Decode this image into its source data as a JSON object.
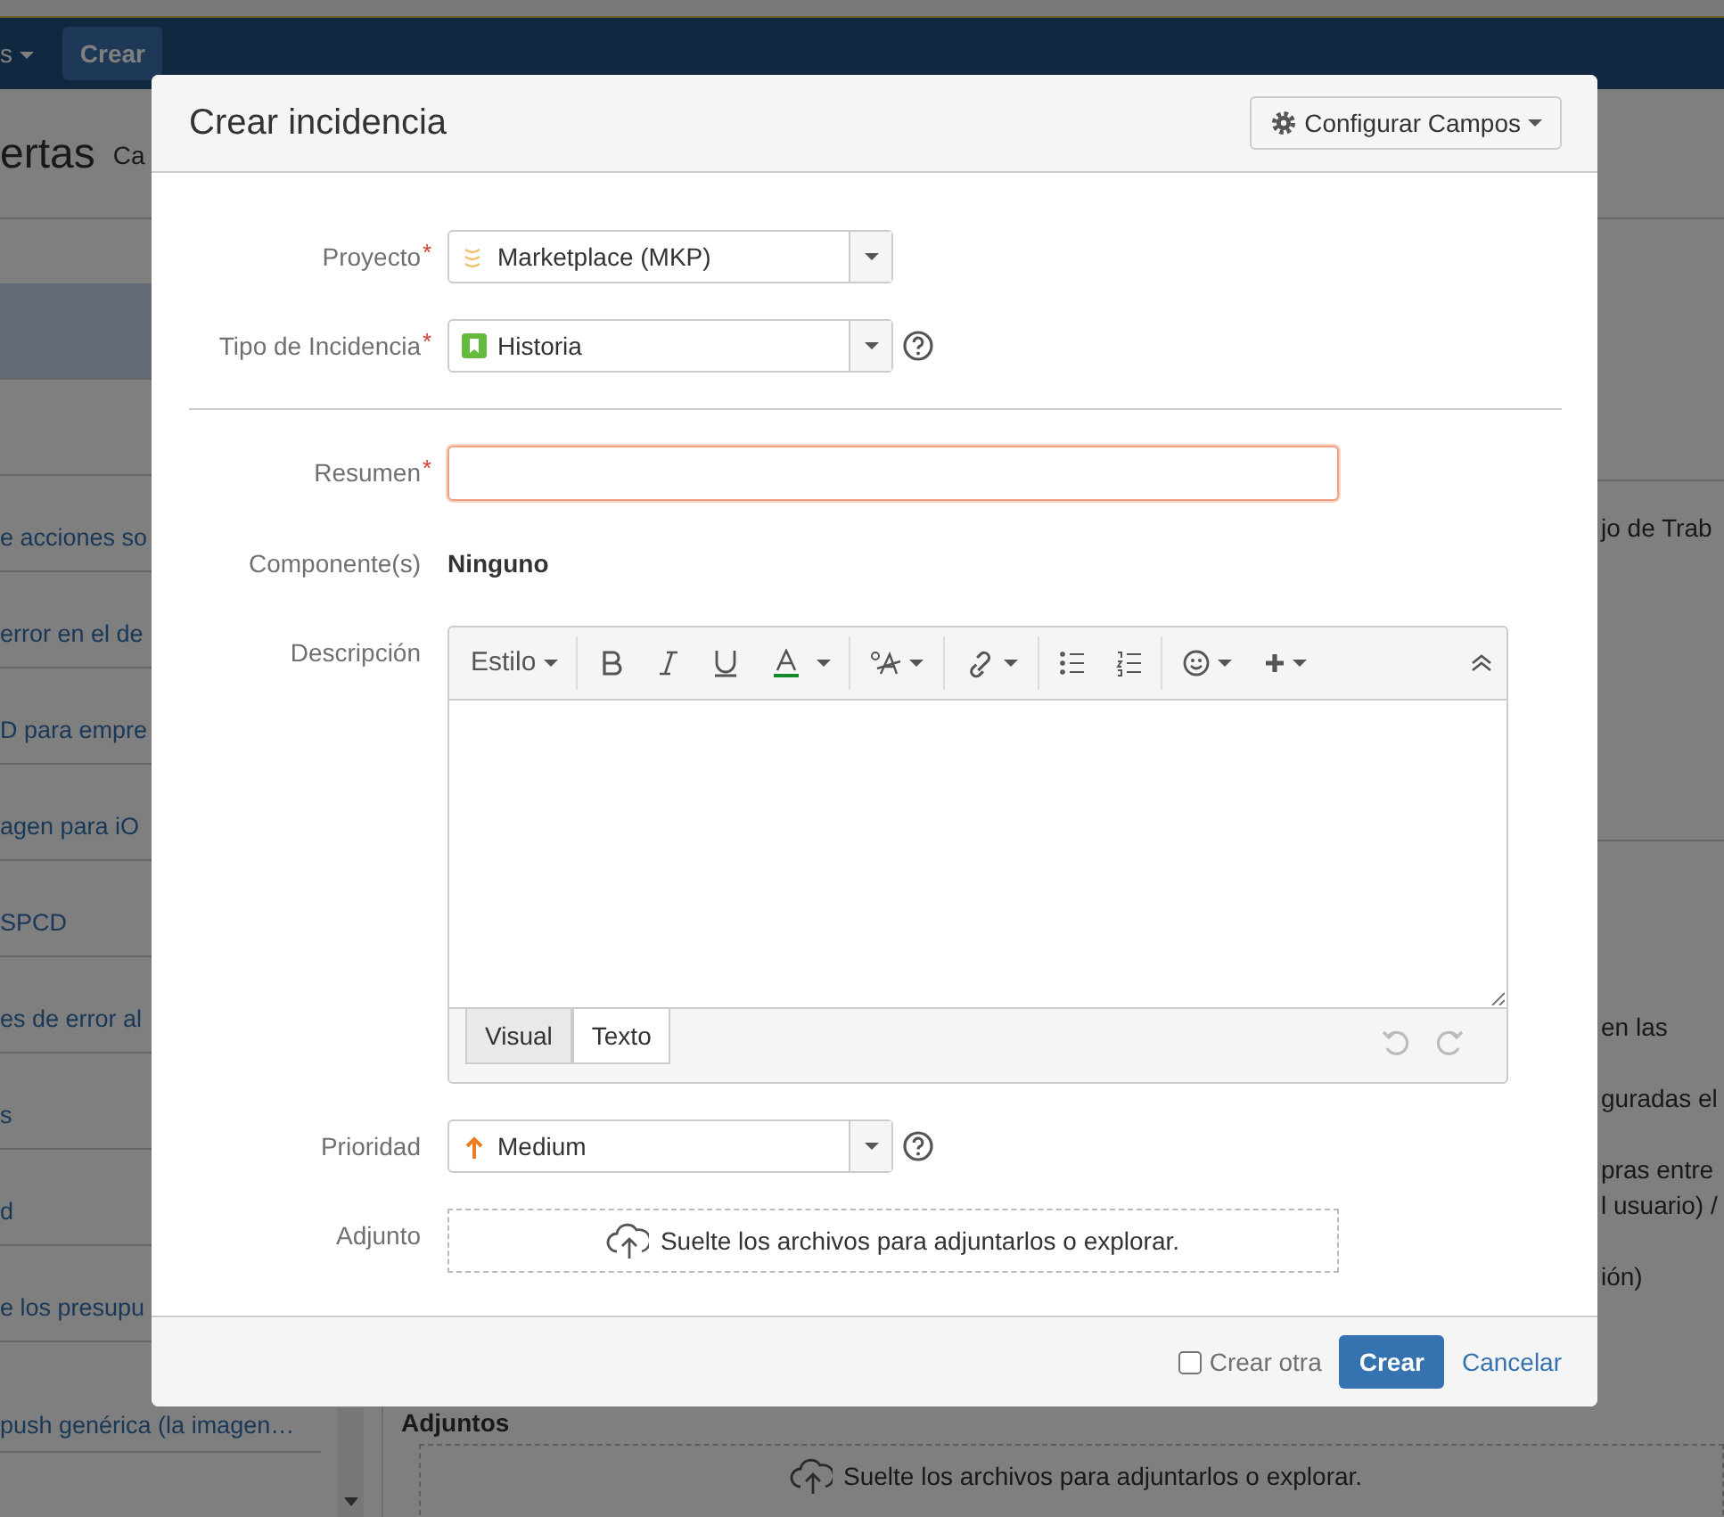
{
  "navbar": {
    "items": [
      {
        "kind": "menu",
        "label": "s"
      },
      {
        "kind": "button",
        "label": "Crear"
      }
    ]
  },
  "page_header": {
    "title": "ertas",
    "link": "Ca"
  },
  "issue_list": {
    "items": [
      {
        "selected": true
      },
      {
        "selected": false
      },
      {
        "text": "e acciones so",
        "selected": false
      },
      {
        "text": "error en el de",
        "selected": false
      },
      {
        "text": "D para empre",
        "selected": false
      },
      {
        "text": "agen para iO",
        "selected": false
      },
      {
        "text": "SPCD",
        "selected": false
      },
      {
        "text": "es de error al",
        "selected": false
      },
      {
        "text": "s",
        "selected": false
      },
      {
        "text": "d",
        "selected": false
      },
      {
        "text": "e los presupu",
        "selected": false
      },
      {
        "text": "push genérica (la imagen…",
        "selected": false
      }
    ]
  },
  "detail_panel": {
    "link": "jo de Trab",
    "paragraphs": [
      [
        "en las"
      ],
      [
        "guradas el"
      ],
      [
        "pras entre",
        "l usuario) /"
      ],
      [
        "ión)"
      ]
    ],
    "attachments": {
      "title": "Adjuntos",
      "drop_text": "Suelte los archivos para adjuntarlos o ",
      "browse_link": "explorar."
    }
  },
  "dialog": {
    "title": "Crear incidencia",
    "config_button": "Configurar Campos",
    "fields": [
      {
        "kind": "select",
        "label": "Proyecto",
        "marker": "*",
        "value": "Marketplace (MKP)",
        "help": false
      },
      {
        "kind": "select",
        "label": "Tipo de Incidencia",
        "marker": "*",
        "value": "Historia",
        "help": true
      },
      {
        "kind": "divider"
      },
      {
        "kind": "text",
        "label": "Resumen",
        "marker": "*",
        "focused": true
      },
      {
        "kind": "static",
        "label": "Componente(s)",
        "value": "Ninguno"
      },
      {
        "kind": "editor",
        "label": "Descripción",
        "style_menu": "Estilo",
        "tabs": [
          {
            "label": "Visual",
            "selected": false
          },
          {
            "label": "Texto",
            "selected": true
          }
        ]
      },
      {
        "kind": "select",
        "label": "Prioridad",
        "value": "Medium",
        "help": true
      },
      {
        "kind": "dropzone",
        "label": "Adjunto",
        "drop_text": "Suelte los archivos para adjuntarlos o ",
        "browse_link": "explorar."
      }
    ],
    "create_another": {
      "label": "Crear otra",
      "checked": false
    },
    "submit": "Crear",
    "cancel": "Cancelar"
  }
}
